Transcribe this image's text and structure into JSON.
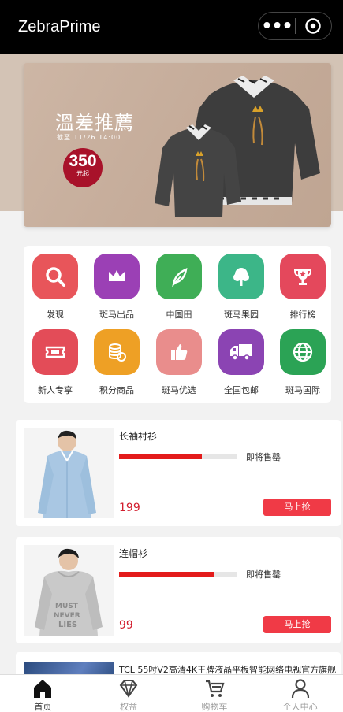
{
  "app": {
    "title": "ZebraPrime"
  },
  "capsule": {
    "more": "•••"
  },
  "banner": {
    "headline": "溫差推薦",
    "subtext": "截至 11/26 14:00",
    "price": "350",
    "price_unit": "元起"
  },
  "categories": [
    {
      "label": "发现",
      "icon": "search-icon",
      "color": "#e8555a"
    },
    {
      "label": "斑马出品",
      "icon": "crown-icon",
      "color": "#9b40b5"
    },
    {
      "label": "中国田",
      "icon": "leaf-icon",
      "color": "#3fae56"
    },
    {
      "label": "斑马果园",
      "icon": "tree-icon",
      "color": "#3cb688"
    },
    {
      "label": "排行榜",
      "icon": "trophy-icon",
      "color": "#e4485c"
    },
    {
      "label": "新人专享",
      "icon": "ticket-icon",
      "color": "#e34c58"
    },
    {
      "label": "积分商品",
      "icon": "coins-icon",
      "color": "#eea025"
    },
    {
      "label": "斑马优选",
      "icon": "thumbs-up-icon",
      "color": "#e98d8c"
    },
    {
      "label": "全国包邮",
      "icon": "truck-icon",
      "color": "#8b44b3"
    },
    {
      "label": "斑马国际",
      "icon": "globe-icon",
      "color": "#2ba355"
    }
  ],
  "products": [
    {
      "name": "长袖衬衫",
      "status": "即将售罄",
      "price": "199",
      "button": "马上抢",
      "progress": 0.7
    },
    {
      "name": "连帽衫",
      "status": "即将售罄",
      "price": "99",
      "button": "马上抢",
      "progress": 0.8
    }
  ],
  "partial_product": {
    "name": "TCL 55吋V2高清4K王牌液晶平板智能网络电视官方旗舰"
  },
  "tabs": [
    {
      "label": "首页",
      "icon": "home-icon",
      "active": true
    },
    {
      "label": "权益",
      "icon": "diamond-icon",
      "active": false
    },
    {
      "label": "购物车",
      "icon": "cart-icon",
      "active": false
    },
    {
      "label": "个人中心",
      "icon": "person-icon",
      "active": false
    }
  ],
  "colors": {
    "accent": "#e31b1b",
    "button": "#f03a46",
    "price": "#d21d2d"
  }
}
